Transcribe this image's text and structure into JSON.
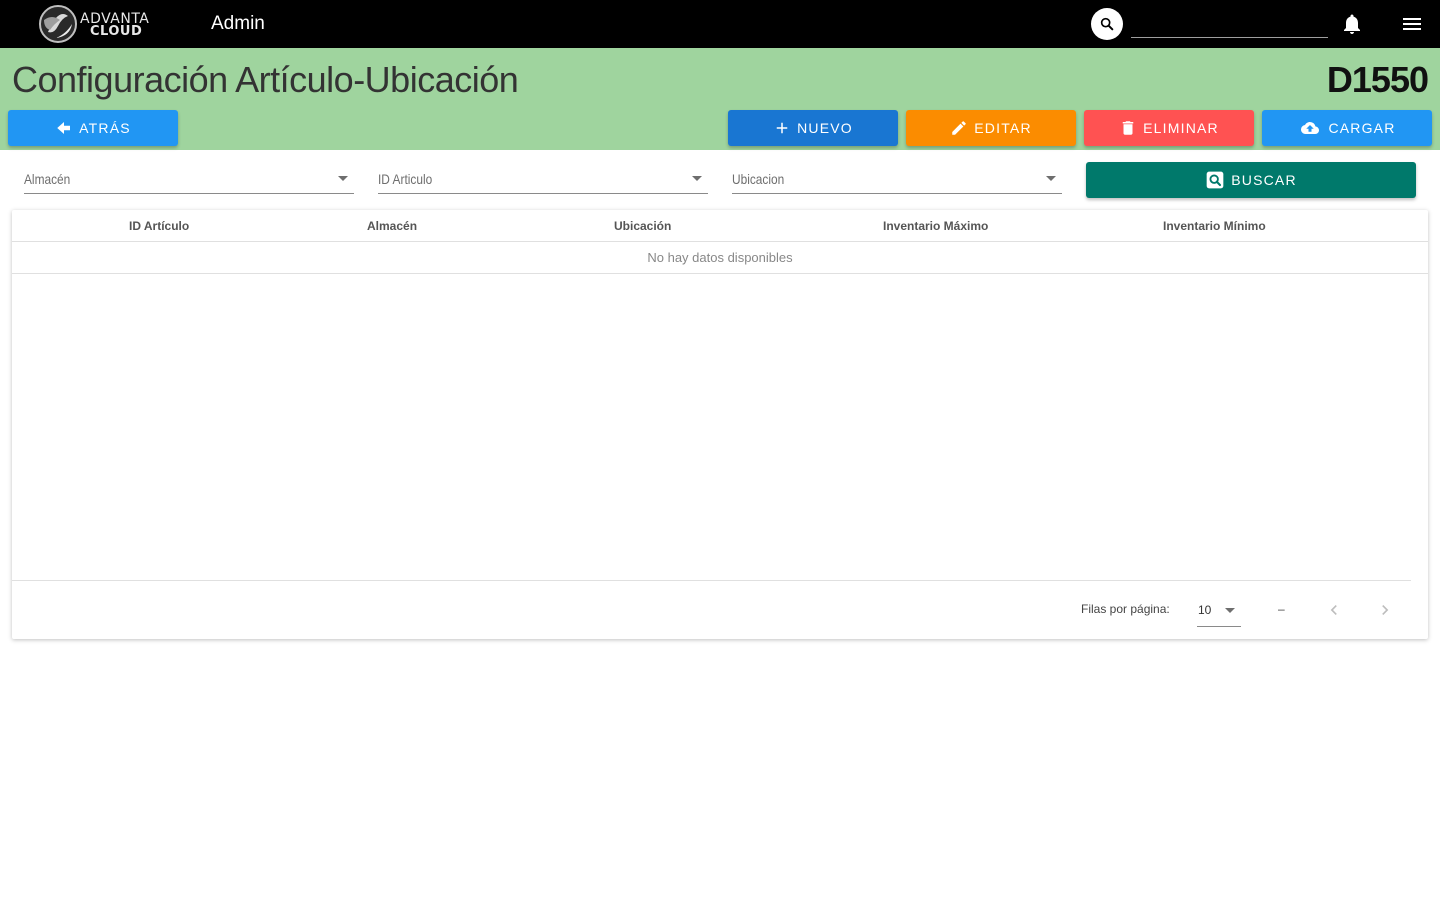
{
  "topbar": {
    "logo_line1": "ADVANTA",
    "logo_line2": "CLOUD",
    "app_title": "Admin",
    "search_placeholder": ""
  },
  "header": {
    "title": "Configuración Artículo-Ubicación",
    "code": "D1550",
    "background": "#9fd49e"
  },
  "actions": {
    "back": "ATRÁS",
    "new": "NUEVO",
    "edit": "EDITAR",
    "delete": "ELIMINAR",
    "upload": "CARGAR",
    "search": "BUSCAR"
  },
  "filters": {
    "warehouse": "Almacén",
    "item_id": "ID Articulo",
    "location": "Ubicacion"
  },
  "table": {
    "columns": [
      "ID Artículo",
      "Almacén",
      "Ubicación",
      "Inventario Máximo",
      "Inventario Mínimo"
    ],
    "empty_message": "No hay datos disponibles",
    "rows_per_page_label": "Filas por página:",
    "rows_per_page_value": "10",
    "range": "–"
  },
  "colors": {
    "back": "#2196f3",
    "new": "#1976d2",
    "edit": "#fb8c00",
    "delete": "#ff5252",
    "upload": "#2196f3",
    "search": "#00796b"
  }
}
